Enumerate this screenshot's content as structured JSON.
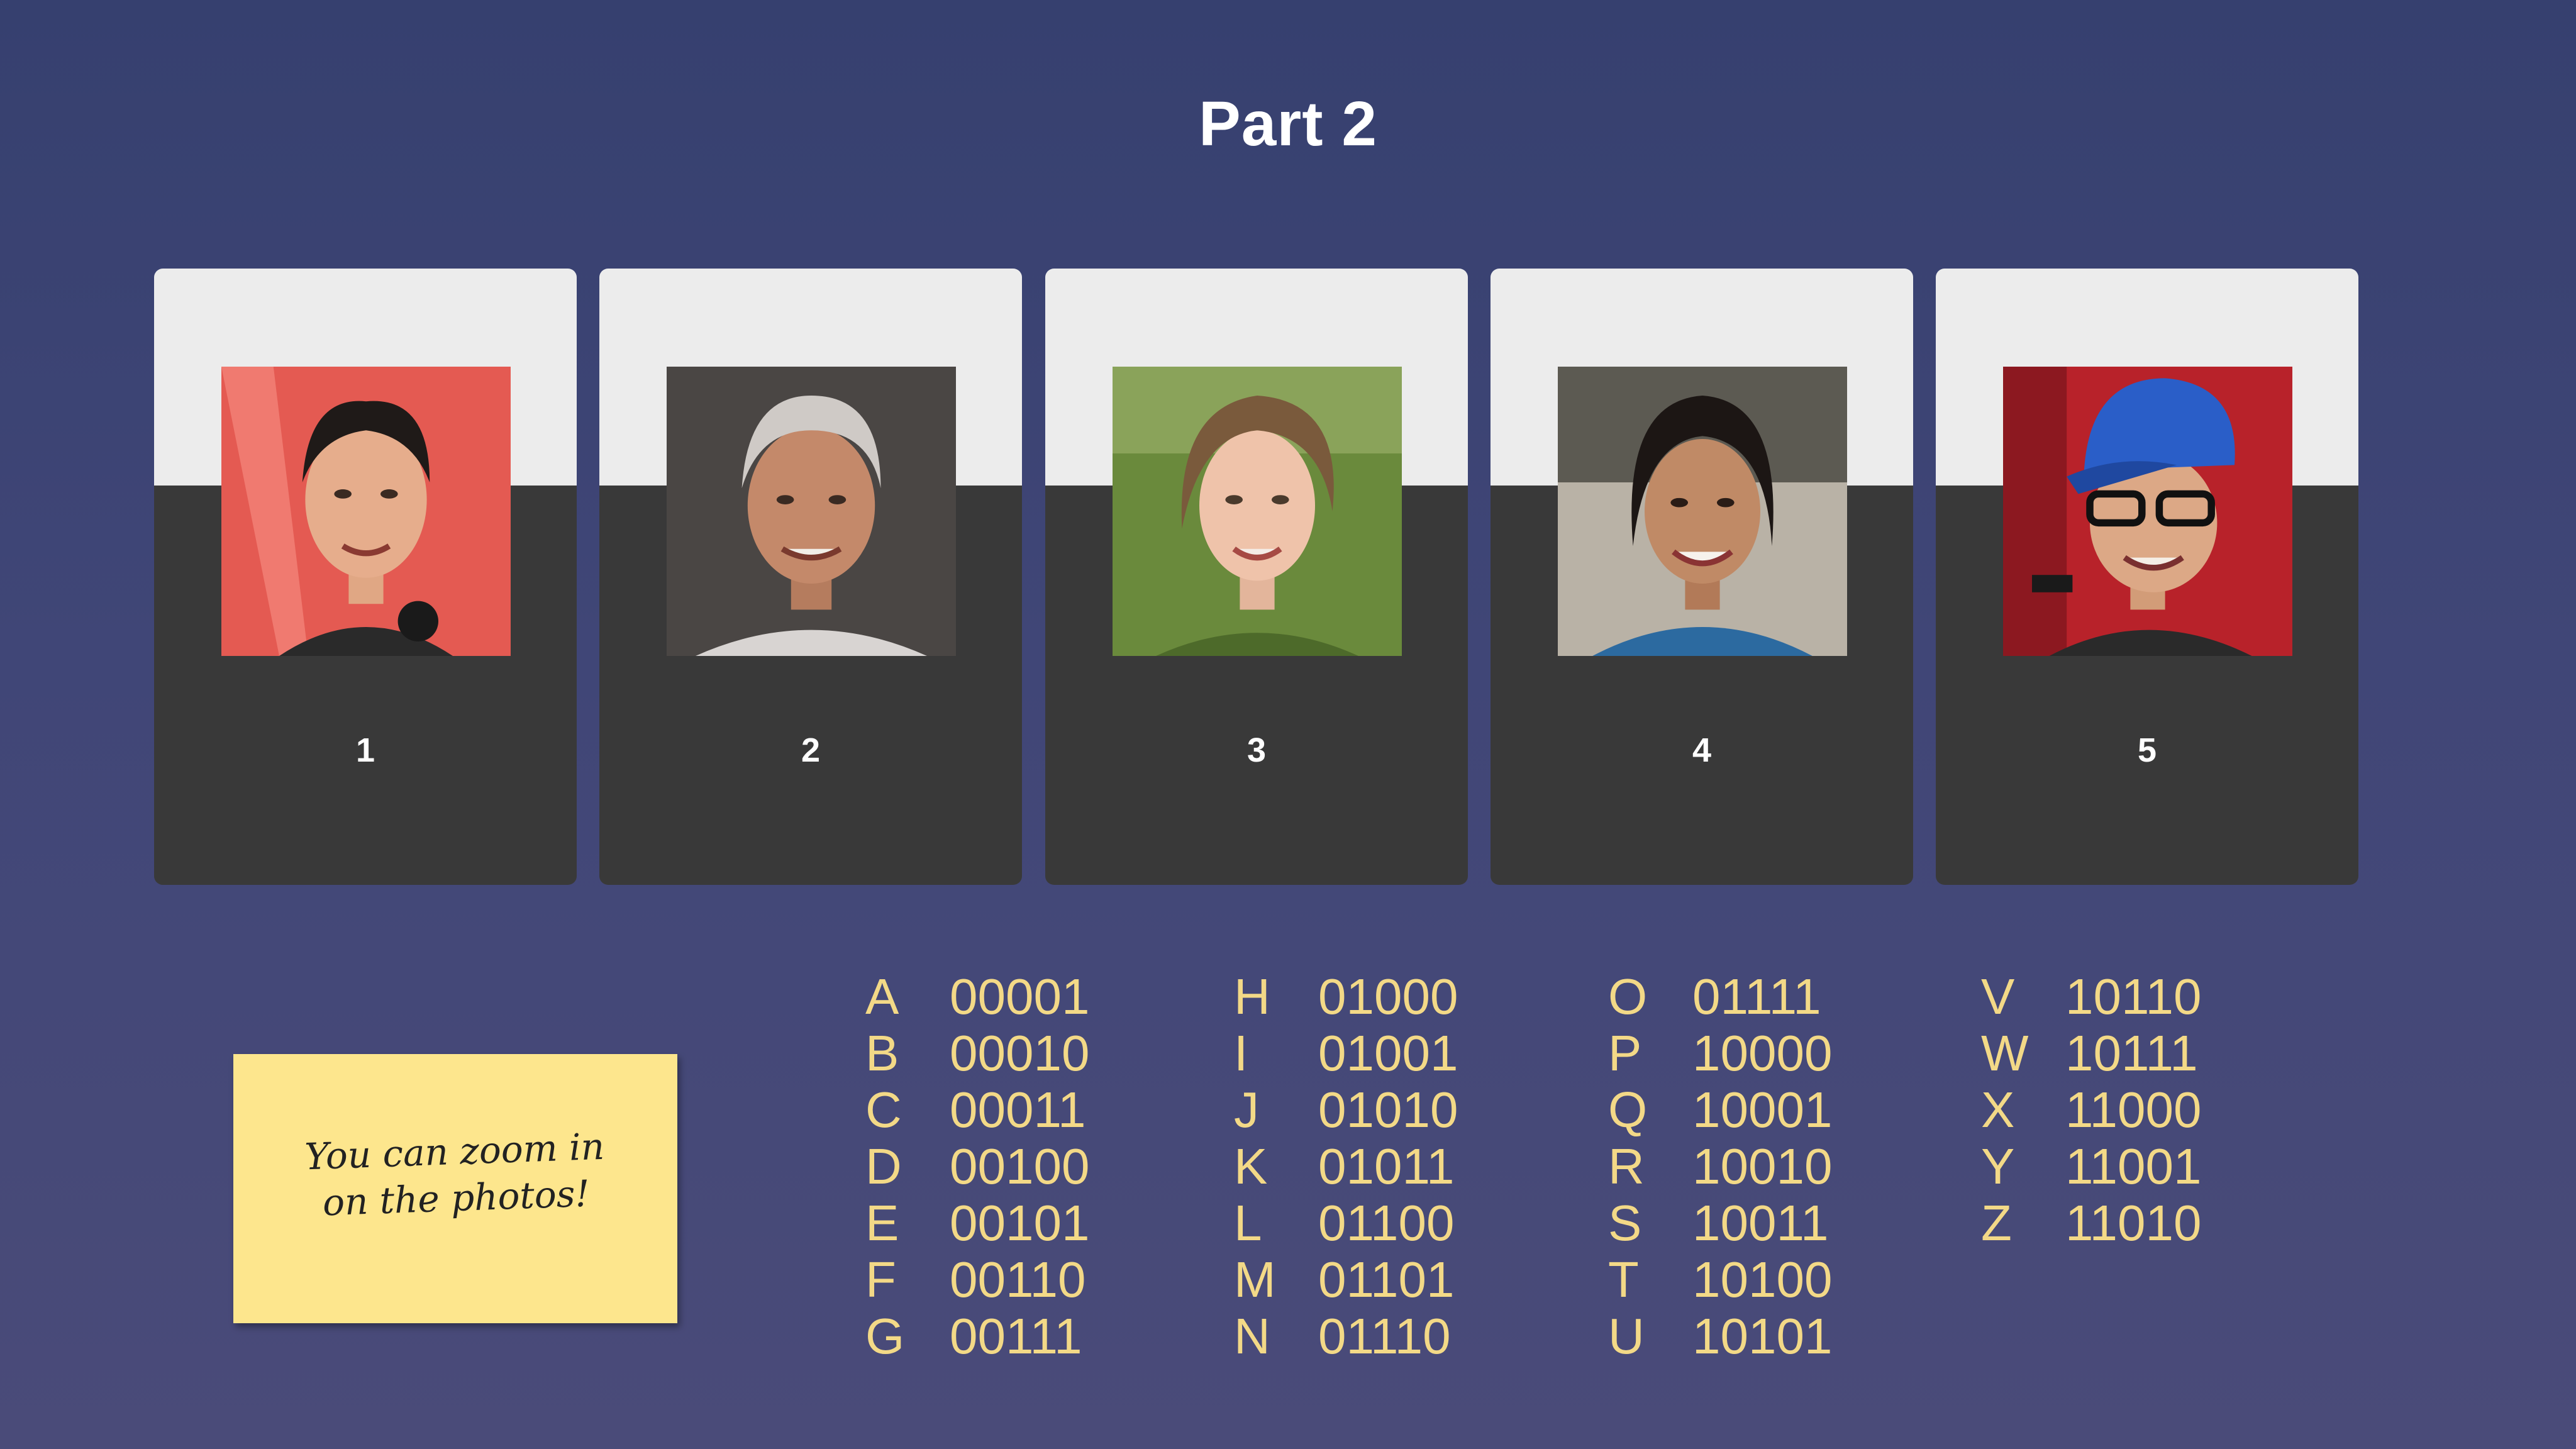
{
  "title": "Part 2",
  "cards": [
    {
      "label": "1"
    },
    {
      "label": "2"
    },
    {
      "label": "3"
    },
    {
      "label": "4"
    },
    {
      "label": "5"
    }
  ],
  "note": {
    "line1": "You can zoom in",
    "line2": "on the photos!"
  },
  "code_columns": [
    [
      {
        "letter": "A",
        "code": "00001"
      },
      {
        "letter": "B",
        "code": "00010"
      },
      {
        "letter": "C",
        "code": "00011"
      },
      {
        "letter": "D",
        "code": "00100"
      },
      {
        "letter": "E",
        "code": "00101"
      },
      {
        "letter": "F",
        "code": "00110"
      },
      {
        "letter": "G",
        "code": "00111"
      }
    ],
    [
      {
        "letter": "H",
        "code": "01000"
      },
      {
        "letter": "I",
        "code": "01001"
      },
      {
        "letter": "J",
        "code": "01010"
      },
      {
        "letter": "K",
        "code": "01011"
      },
      {
        "letter": "L",
        "code": "01100"
      },
      {
        "letter": "M",
        "code": "01101"
      },
      {
        "letter": "N",
        "code": "01110"
      }
    ],
    [
      {
        "letter": "O",
        "code": "01111"
      },
      {
        "letter": "P",
        "code": "10000"
      },
      {
        "letter": "Q",
        "code": "10001"
      },
      {
        "letter": "R",
        "code": "10010"
      },
      {
        "letter": "S",
        "code": "10011"
      },
      {
        "letter": "T",
        "code": "10100"
      },
      {
        "letter": "U",
        "code": "10101"
      }
    ],
    [
      {
        "letter": "V",
        "code": "10110"
      },
      {
        "letter": "W",
        "code": "10111"
      },
      {
        "letter": "X",
        "code": "11000"
      },
      {
        "letter": "Y",
        "code": "11001"
      },
      {
        "letter": "Z",
        "code": "11010"
      }
    ]
  ],
  "colors": {
    "background": "#3c4374",
    "card_top": "#ececec",
    "card_bottom": "#393939",
    "code_text": "#f3d987",
    "sticky_note": "#fde68d"
  }
}
